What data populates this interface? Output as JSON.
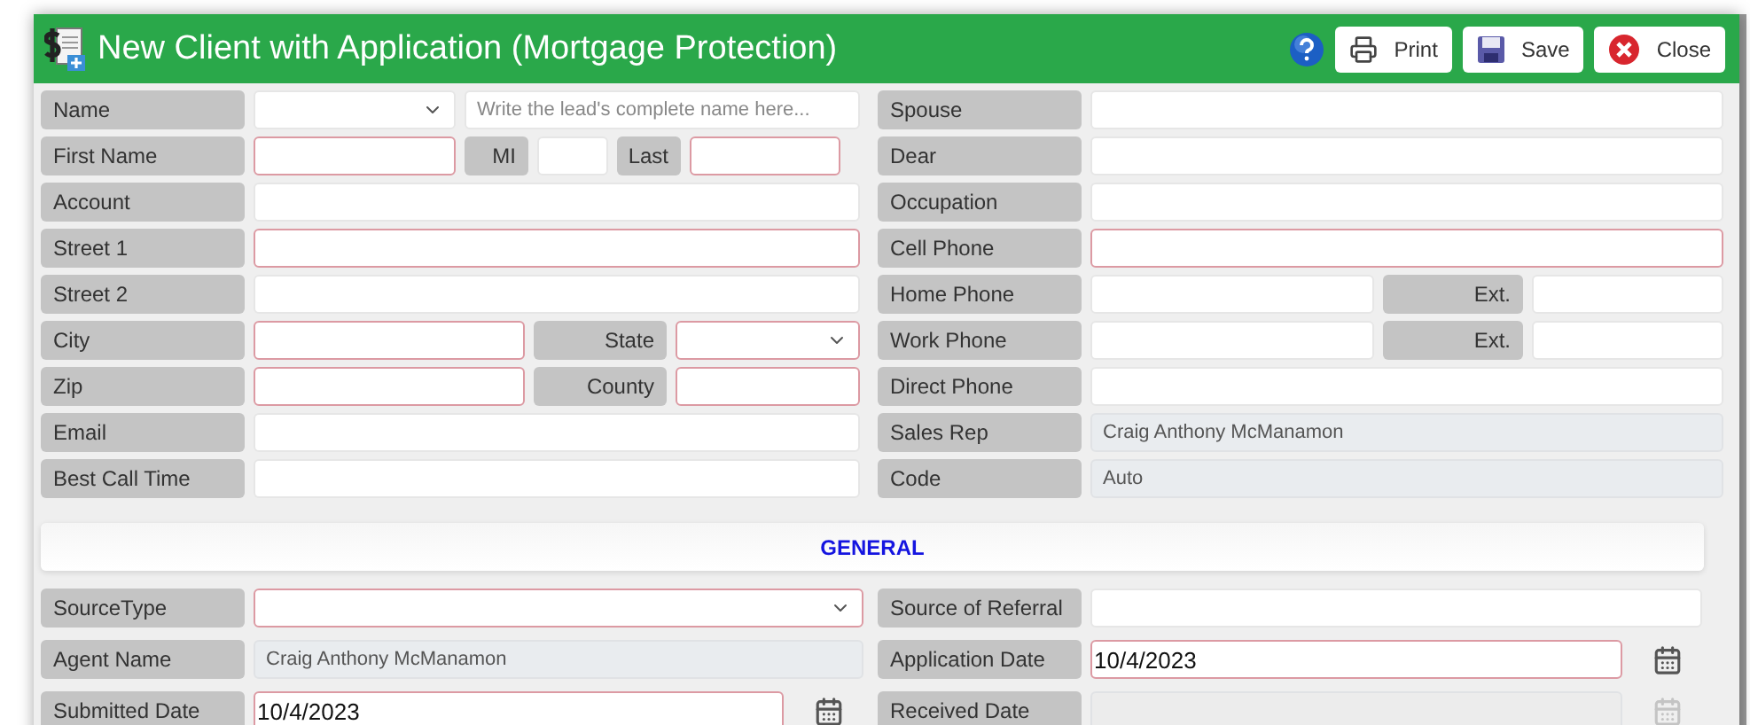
{
  "window": {
    "title": "New Client with Application (Mortgage Protection)"
  },
  "toolbar": [
    {
      "kind": "help"
    },
    {
      "kind": "print",
      "label": "Print"
    },
    {
      "kind": "save",
      "label": "Save"
    },
    {
      "kind": "close",
      "label": "Close"
    }
  ],
  "contact": {
    "left": [
      {
        "kind": "name",
        "cells": [
          {
            "kind": "label",
            "text": "Name"
          },
          {
            "kind": "select",
            "required": false,
            "disabled": false
          },
          {
            "kind": "text",
            "required": false,
            "disabled": false,
            "placeholder": "Write the lead's complete name here..."
          }
        ]
      },
      {
        "kind": "first",
        "cells": [
          {
            "kind": "label",
            "text": "First Name"
          },
          {
            "kind": "text",
            "required": true,
            "disabled": false
          },
          {
            "kind": "sublabel",
            "text": "MI"
          },
          {
            "kind": "text",
            "required": false,
            "disabled": false
          },
          {
            "kind": "sublabel",
            "text": "Last"
          },
          {
            "kind": "text",
            "required": true,
            "disabled": false
          }
        ]
      },
      {
        "kind": "full",
        "cells": [
          {
            "kind": "label",
            "text": "Account"
          },
          {
            "kind": "text",
            "required": false,
            "disabled": false
          }
        ]
      },
      {
        "kind": "full",
        "cells": [
          {
            "kind": "label",
            "text": "Street 1"
          },
          {
            "kind": "text",
            "required": true,
            "disabled": false
          }
        ]
      },
      {
        "kind": "full",
        "cells": [
          {
            "kind": "label",
            "text": "Street 2"
          },
          {
            "kind": "text",
            "required": false,
            "disabled": false
          }
        ]
      },
      {
        "kind": "split",
        "cells": [
          {
            "kind": "label",
            "text": "City"
          },
          {
            "kind": "text",
            "required": true,
            "disabled": false
          },
          {
            "kind": "sublabel",
            "text": "State"
          },
          {
            "kind": "select",
            "required": true,
            "disabled": false
          }
        ]
      },
      {
        "kind": "split",
        "cells": [
          {
            "kind": "label",
            "text": "Zip"
          },
          {
            "kind": "text",
            "required": true,
            "disabled": false
          },
          {
            "kind": "sublabel",
            "text": "County"
          },
          {
            "kind": "text",
            "required": true,
            "disabled": false
          }
        ]
      },
      {
        "kind": "full",
        "cells": [
          {
            "kind": "label",
            "text": "Email"
          },
          {
            "kind": "text",
            "required": false,
            "disabled": false
          }
        ]
      },
      {
        "kind": "full",
        "cells": [
          {
            "kind": "label",
            "text": "Best Call Time"
          },
          {
            "kind": "text",
            "required": false,
            "disabled": false
          }
        ]
      }
    ],
    "right": [
      {
        "kind": "full",
        "cells": [
          {
            "kind": "label",
            "text": "Spouse"
          },
          {
            "kind": "text",
            "required": false,
            "disabled": false
          }
        ]
      },
      {
        "kind": "full",
        "cells": [
          {
            "kind": "label",
            "text": "Dear"
          },
          {
            "kind": "text",
            "required": false,
            "disabled": false
          }
        ]
      },
      {
        "kind": "full",
        "cells": [
          {
            "kind": "label",
            "text": "Occupation"
          },
          {
            "kind": "text",
            "required": false,
            "disabled": false
          }
        ]
      },
      {
        "kind": "full",
        "cells": [
          {
            "kind": "label",
            "text": "Cell Phone"
          },
          {
            "kind": "text",
            "required": true,
            "disabled": false
          }
        ]
      },
      {
        "kind": "ext",
        "cells": [
          {
            "kind": "label",
            "text": "Home Phone"
          },
          {
            "kind": "text",
            "required": false,
            "disabled": false
          },
          {
            "kind": "sublabel",
            "text": "Ext."
          },
          {
            "kind": "text",
            "required": false,
            "disabled": false
          }
        ]
      },
      {
        "kind": "ext",
        "cells": [
          {
            "kind": "label",
            "text": "Work Phone"
          },
          {
            "kind": "text",
            "required": false,
            "disabled": false
          },
          {
            "kind": "sublabel",
            "text": "Ext."
          },
          {
            "kind": "text",
            "required": false,
            "disabled": false
          }
        ]
      },
      {
        "kind": "full",
        "cells": [
          {
            "kind": "label",
            "text": "Direct Phone"
          },
          {
            "kind": "text",
            "required": false,
            "disabled": false
          }
        ]
      },
      {
        "kind": "full",
        "cells": [
          {
            "kind": "label",
            "text": "Sales Rep"
          },
          {
            "kind": "text",
            "required": false,
            "disabled": true,
            "value": "Craig Anthony McManamon"
          }
        ]
      },
      {
        "kind": "full",
        "cells": [
          {
            "kind": "label",
            "text": "Code"
          },
          {
            "kind": "text",
            "required": false,
            "disabled": true,
            "value": "Auto"
          }
        ]
      }
    ]
  },
  "general": {
    "title": "GENERAL",
    "left": [
      {
        "kind": "full",
        "cells": [
          {
            "kind": "label",
            "text": "SourceType"
          },
          {
            "kind": "select",
            "required": true,
            "disabled": false
          }
        ]
      },
      {
        "kind": "full",
        "cells": [
          {
            "kind": "label",
            "text": "Agent Name"
          },
          {
            "kind": "text",
            "required": false,
            "disabled": true,
            "value": "Craig Anthony McManamon"
          }
        ]
      },
      {
        "kind": "date",
        "cells": [
          {
            "kind": "label",
            "text": "Submitted Date"
          },
          {
            "kind": "date",
            "required": true,
            "disabled": false,
            "value": "10/4/2023"
          }
        ]
      }
    ],
    "right": [
      {
        "kind": "full",
        "cells": [
          {
            "kind": "label",
            "text": "Source of Referral"
          },
          {
            "kind": "text",
            "required": false,
            "disabled": false
          }
        ]
      },
      {
        "kind": "date",
        "cells": [
          {
            "kind": "label",
            "text": "Application Date"
          },
          {
            "kind": "date",
            "required": true,
            "disabled": false,
            "value": "10/4/2023"
          }
        ]
      },
      {
        "kind": "date",
        "cells": [
          {
            "kind": "label",
            "text": "Received Date"
          },
          {
            "kind": "date",
            "required": false,
            "disabled": true
          }
        ]
      }
    ]
  }
}
